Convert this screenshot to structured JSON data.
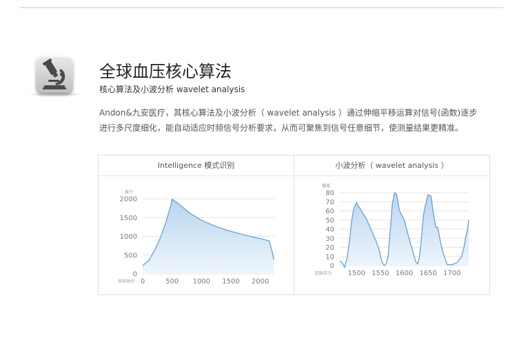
{
  "header": {
    "title": "全球血压核心算法",
    "subtitle": "核心算法及小波分析 wavelet analysis",
    "icon": "microscope-icon"
  },
  "description": {
    "line1": "Andon&九安医疗，其核心算法及小波分析（ wavelet analysis ）通过伸缩平移运算对信号(函数)逐步",
    "line2": "进行多尺度细化，能自动适应时频信号分析要求，从而可聚焦到信号任意细节，使测量结果更精准。"
  },
  "colors": {
    "line": "#6a9fcf",
    "fill_top": "#b5d3ef",
    "fill_bottom": "#eef5fc",
    "grid": "#e3e3e3",
    "axis_text": "#7a7a7a"
  },
  "chart_data": [
    {
      "type": "area",
      "panel_title": "Intelligence 模式识别",
      "ylabel": "振力",
      "xlabel": "采样时间",
      "xlim": [
        0,
        2250
      ],
      "ylim": [
        0,
        2000
      ],
      "x_ticks": [
        0,
        500,
        1000,
        1500,
        2000
      ],
      "y_ticks": [
        0,
        500,
        1000,
        1500,
        2000
      ],
      "grid": true,
      "x": [
        0,
        100,
        200,
        300,
        400,
        480,
        500,
        600,
        800,
        1000,
        1200,
        1400,
        1600,
        1800,
        2000,
        2150,
        2200,
        2230
      ],
      "y": [
        220,
        350,
        620,
        960,
        1400,
        1840,
        1990,
        1880,
        1620,
        1430,
        1290,
        1180,
        1090,
        1010,
        940,
        880,
        600,
        380
      ]
    },
    {
      "type": "area",
      "panel_title": "小波分析（ wavelet analysis ）",
      "ylabel": "幅值",
      "xlabel": "起始压力",
      "xlim": [
        1465,
        1735
      ],
      "ylim": [
        0,
        80
      ],
      "x_ticks": [
        1500,
        1550,
        1600,
        1650,
        1700
      ],
      "y_ticks": [
        0,
        10,
        20,
        30,
        40,
        50,
        60,
        70,
        80
      ],
      "grid": true,
      "x": [
        1465,
        1470,
        1475,
        1480,
        1486,
        1490,
        1494,
        1500,
        1510,
        1520,
        1530,
        1540,
        1547,
        1553,
        1558,
        1562,
        1566,
        1570,
        1575,
        1580,
        1584,
        1590,
        1600,
        1610,
        1618,
        1624,
        1628,
        1632,
        1636,
        1640,
        1645,
        1650,
        1656,
        1660,
        1666,
        1670,
        1675,
        1680,
        1690,
        1700,
        1710,
        1720,
        1725,
        1728,
        1732,
        1735
      ],
      "y": [
        5,
        3,
        -2,
        8,
        30,
        50,
        62,
        69,
        60,
        52,
        40,
        28,
        18,
        4,
        0,
        2,
        10,
        35,
        68,
        80,
        78,
        60,
        50,
        30,
        15,
        4,
        2,
        10,
        30,
        55,
        68,
        78,
        76,
        60,
        42,
        42,
        28,
        16,
        1,
        1,
        3,
        10,
        20,
        30,
        38,
        50
      ]
    }
  ]
}
